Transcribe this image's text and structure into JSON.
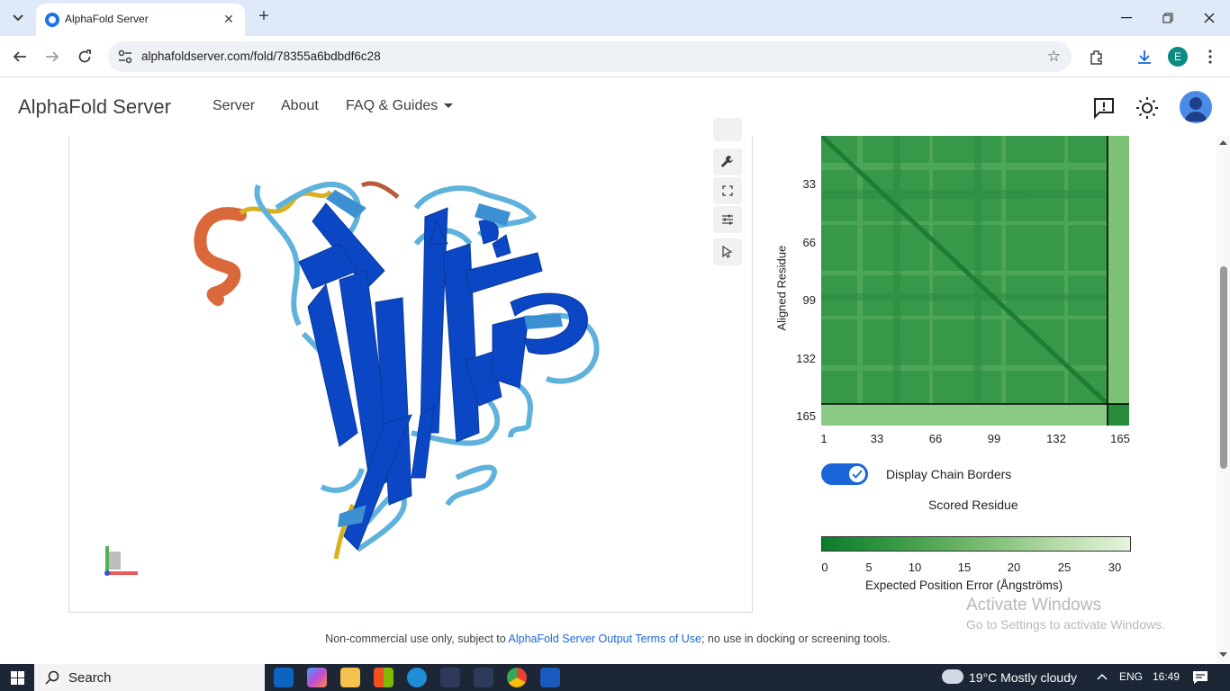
{
  "browser": {
    "tab_title": "AlphaFold Server",
    "url": "alphafoldserver.com/fold/78355a6bdbdf6c28",
    "profile_initial": "E"
  },
  "app": {
    "brand": "AlphaFold Server",
    "nav": {
      "server": "Server",
      "about": "About",
      "faq": "FAQ & Guides"
    }
  },
  "pae": {
    "ylabel": "Aligned Residue",
    "yticks": [
      "33",
      "66",
      "99",
      "132",
      "165"
    ],
    "xticks": [
      "1",
      "33",
      "66",
      "99",
      "132",
      "165"
    ],
    "toggle_label": "Display Chain Borders",
    "toggle_on": true,
    "xlabel": "Scored Residue",
    "colorbar_ticks": [
      "0",
      "5",
      "10",
      "15",
      "20",
      "25",
      "30"
    ],
    "colorbar_label": "Expected Position Error (Ångströms)",
    "colors": {
      "low": "#0a7d2d",
      "high": "#e7f4dd"
    }
  },
  "watermark": {
    "line1": "Activate Windows",
    "line2": "Go to Settings to activate Windows."
  },
  "footer": {
    "prefix": "Non-commercial use only, subject to ",
    "link": "AlphaFold Server Output Terms of Use",
    "suffix": "; no use in docking or screening tools."
  },
  "taskbar": {
    "search": "Search",
    "weather": "19°C  Mostly cloudy",
    "lang": "ENG",
    "time": "16:49"
  }
}
